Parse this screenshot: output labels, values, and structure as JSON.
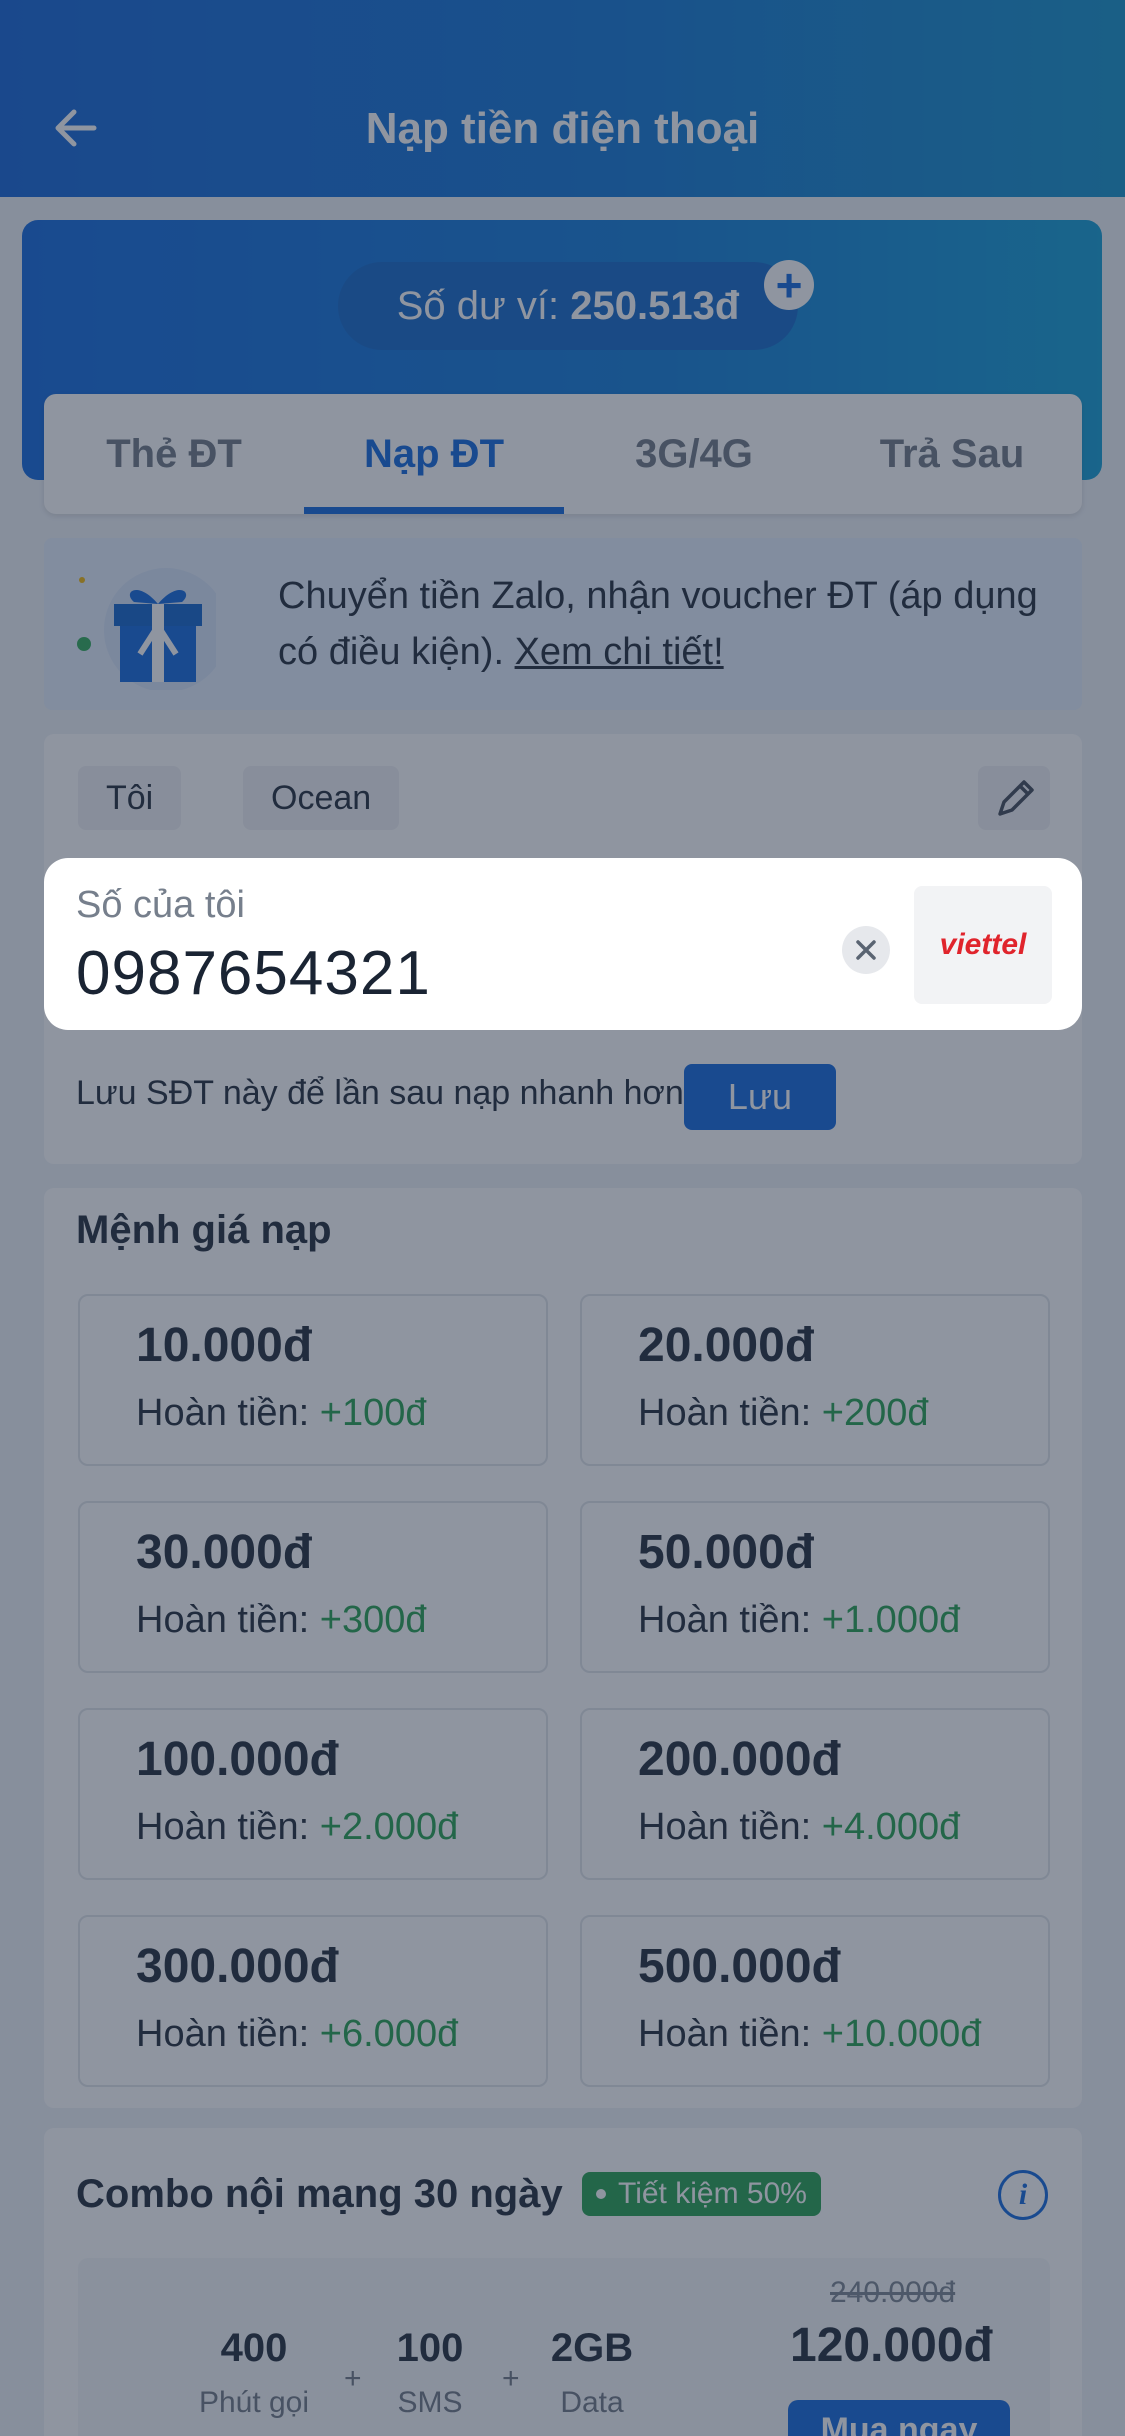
{
  "header": {
    "title": "Nạp tiền điện thoại"
  },
  "wallet": {
    "label": "Số dư ví: ",
    "balance": "250.513đ",
    "add": "+"
  },
  "tabs": [
    {
      "label": "Thẻ ĐT"
    },
    {
      "label": "Nạp ĐT",
      "active": true
    },
    {
      "label": "3G/4G"
    },
    {
      "label": "Trả Sau"
    }
  ],
  "promo": {
    "text": "Chuyển tiền Zalo, nhận voucher ĐT (áp dụng có điều kiện). ",
    "link": "Xem chi tiết!"
  },
  "contacts": [
    {
      "label": "Tôi"
    },
    {
      "label": "Ocean"
    }
  ],
  "phone": {
    "label": "Số của tôi",
    "value": "0987654321",
    "carrier": "viettel"
  },
  "save": {
    "text": "Lưu SĐT này để lần sau nạp nhanh hơn",
    "button": "Lưu"
  },
  "denominations": {
    "title": "Mệnh giá nạp",
    "cashback_label": "Hoàn tiền: ",
    "items": [
      {
        "amount": "10.000đ",
        "cashback": "+100đ"
      },
      {
        "amount": "20.000đ",
        "cashback": "+200đ"
      },
      {
        "amount": "30.000đ",
        "cashback": "+300đ"
      },
      {
        "amount": "50.000đ",
        "cashback": "+1.000đ"
      },
      {
        "amount": "100.000đ",
        "cashback": "+2.000đ"
      },
      {
        "amount": "200.000đ",
        "cashback": "+4.000đ"
      },
      {
        "amount": "300.000đ",
        "cashback": "+6.000đ"
      },
      {
        "amount": "500.000đ",
        "cashback": "+10.000đ"
      }
    ]
  },
  "combo": {
    "title": "Combo nội mạng 30 ngày",
    "badge": "Tiết kiệm 50%",
    "info": "i",
    "items": [
      {
        "value": "400",
        "label": "Phút gọi"
      },
      {
        "value": "100",
        "label": "SMS"
      },
      {
        "value": "2GB",
        "label": "Data"
      }
    ],
    "plus": "+",
    "old_price": "240.000đ",
    "price": "120.000đ",
    "buy": "Mua ngay"
  },
  "colors": {
    "primary": "#0a63dc",
    "green": "#1f9e4a",
    "overlay": "rgba(40,52,72,0.52)",
    "carrier_red": "#e0242c"
  }
}
